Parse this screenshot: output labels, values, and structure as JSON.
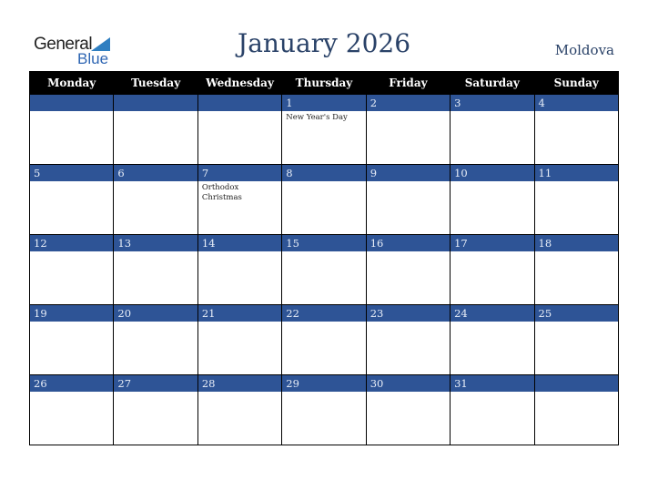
{
  "logo": {
    "line1": "General",
    "line2": "Blue",
    "icon": "triangle-flag-icon"
  },
  "header": {
    "title": "January 2026",
    "country": "Moldova"
  },
  "colors": {
    "header_bg": "#000000",
    "day_bar": "#2e5496",
    "title": "#2a4268",
    "logo_blue": "#2f7fc1"
  },
  "weekdays": [
    "Monday",
    "Tuesday",
    "Wednesday",
    "Thursday",
    "Friday",
    "Saturday",
    "Sunday"
  ],
  "weeks": [
    [
      {
        "day": "",
        "event": ""
      },
      {
        "day": "",
        "event": ""
      },
      {
        "day": "",
        "event": ""
      },
      {
        "day": "1",
        "event": "New Year's Day"
      },
      {
        "day": "2",
        "event": ""
      },
      {
        "day": "3",
        "event": ""
      },
      {
        "day": "4",
        "event": ""
      }
    ],
    [
      {
        "day": "5",
        "event": ""
      },
      {
        "day": "6",
        "event": ""
      },
      {
        "day": "7",
        "event": "Orthodox Christmas"
      },
      {
        "day": "8",
        "event": ""
      },
      {
        "day": "9",
        "event": ""
      },
      {
        "day": "10",
        "event": ""
      },
      {
        "day": "11",
        "event": ""
      }
    ],
    [
      {
        "day": "12",
        "event": ""
      },
      {
        "day": "13",
        "event": ""
      },
      {
        "day": "14",
        "event": ""
      },
      {
        "day": "15",
        "event": ""
      },
      {
        "day": "16",
        "event": ""
      },
      {
        "day": "17",
        "event": ""
      },
      {
        "day": "18",
        "event": ""
      }
    ],
    [
      {
        "day": "19",
        "event": ""
      },
      {
        "day": "20",
        "event": ""
      },
      {
        "day": "21",
        "event": ""
      },
      {
        "day": "22",
        "event": ""
      },
      {
        "day": "23",
        "event": ""
      },
      {
        "day": "24",
        "event": ""
      },
      {
        "day": "25",
        "event": ""
      }
    ],
    [
      {
        "day": "26",
        "event": ""
      },
      {
        "day": "27",
        "event": ""
      },
      {
        "day": "28",
        "event": ""
      },
      {
        "day": "29",
        "event": ""
      },
      {
        "day": "30",
        "event": ""
      },
      {
        "day": "31",
        "event": ""
      },
      {
        "day": "",
        "event": ""
      }
    ]
  ]
}
